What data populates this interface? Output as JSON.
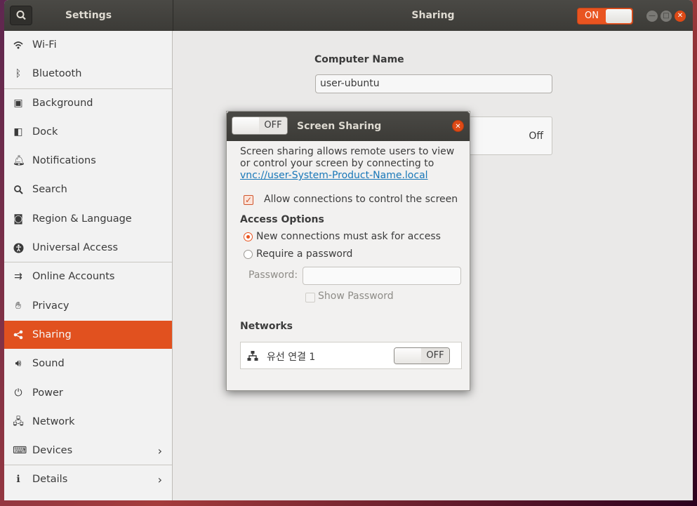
{
  "header": {
    "settings_title": "Settings",
    "panel_title": "Sharing",
    "sharing_toggle": "ON"
  },
  "sidebar": {
    "items": [
      {
        "label": "Wi-Fi",
        "icon": "wifi-icon"
      },
      {
        "label": "Bluetooth",
        "icon": "bluetooth-icon"
      },
      {
        "label": "Background",
        "icon": "background-icon"
      },
      {
        "label": "Dock",
        "icon": "dock-icon"
      },
      {
        "label": "Notifications",
        "icon": "bell-icon"
      },
      {
        "label": "Search",
        "icon": "search-icon"
      },
      {
        "label": "Region & Language",
        "icon": "camera-icon"
      },
      {
        "label": "Universal Access",
        "icon": "accessibility-icon"
      },
      {
        "label": "Online Accounts",
        "icon": "online-accounts-icon"
      },
      {
        "label": "Privacy",
        "icon": "hand-icon"
      },
      {
        "label": "Sharing",
        "icon": "share-icon"
      },
      {
        "label": "Sound",
        "icon": "speaker-icon"
      },
      {
        "label": "Power",
        "icon": "power-icon"
      },
      {
        "label": "Network",
        "icon": "network-icon"
      },
      {
        "label": "Devices",
        "icon": "devices-icon"
      },
      {
        "label": "Details",
        "icon": "info-icon"
      }
    ],
    "active": "Sharing"
  },
  "main": {
    "computer_name_label": "Computer Name",
    "computer_name_value": "user-ubuntu",
    "service_status": "Off"
  },
  "dialog": {
    "title": "Screen Sharing",
    "toggle": "OFF",
    "description": "Screen sharing allows remote users to view or control your screen by connecting to",
    "link": "vnc://user-System-Product-Name.local",
    "allow_control_label": "Allow connections to control the screen",
    "allow_control_checked": true,
    "access_options_heading": "Access Options",
    "option_ask": "New connections must ask for access",
    "option_password": "Require a password",
    "selected_option": "option_ask",
    "password_label": "Password:",
    "password_value": "",
    "show_password_label": "Show Password",
    "networks_heading": "Networks",
    "network_name": "유선 연결 1",
    "network_toggle": "OFF"
  },
  "colors": {
    "accent": "#e95420",
    "header_bg": "#3c3b37",
    "link": "#1877b8"
  }
}
